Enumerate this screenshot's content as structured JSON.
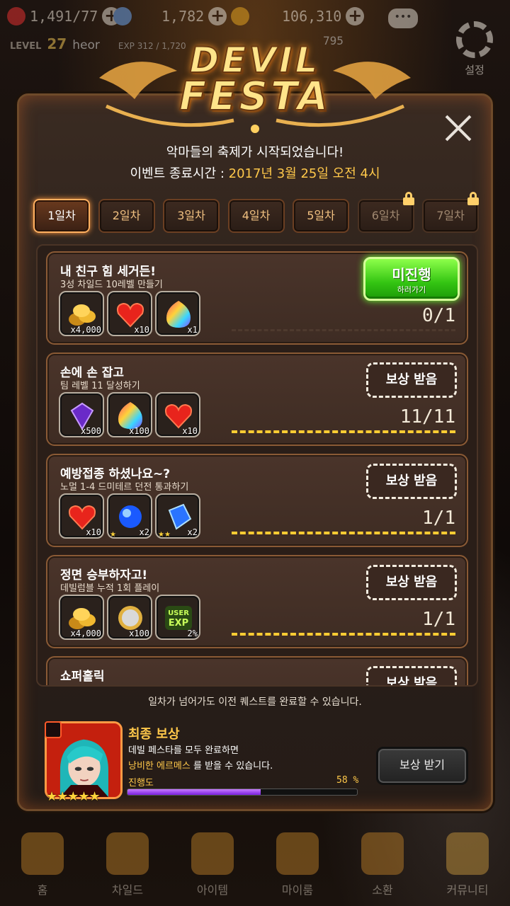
{
  "status_bar": {
    "stamina": "1,491/77",
    "gems": "1,782",
    "gold": "106,310",
    "stamina_extra": "795",
    "level_label": "LEVEL",
    "level": "27",
    "player_name": "heor",
    "exp": "EXP 312 / 1,720",
    "settings_label": "설정"
  },
  "logo": {
    "line1": "DEVIL",
    "line2": "FESTA"
  },
  "modal": {
    "subtitle": "악마들의 축제가 시작되었습니다!",
    "event_time_label": "이벤트 종료시간 : ",
    "event_time_value": "2017년 3월 25일 오전 4시",
    "tabs": [
      {
        "label": "1일차",
        "state": "active"
      },
      {
        "label": "2일차",
        "state": "normal"
      },
      {
        "label": "3일차",
        "state": "normal"
      },
      {
        "label": "4일차",
        "state": "normal"
      },
      {
        "label": "5일차",
        "state": "normal"
      },
      {
        "label": "6일차",
        "state": "locked"
      },
      {
        "label": "7일차",
        "state": "locked"
      }
    ],
    "quests": [
      {
        "title": "내 친구 힘 세거든!",
        "desc": "3성 차일드 10레벨 만들기",
        "rewards": [
          {
            "icon": "gold-coins-icon",
            "count": "x4,000"
          },
          {
            "icon": "heart-icon",
            "count": "x10"
          },
          {
            "icon": "rainbow-gem-icon",
            "count": "x1"
          }
        ],
        "progress": "0/1",
        "button": {
          "type": "in-progress",
          "line1": "미진행",
          "line2": "하러가기"
        }
      },
      {
        "title": "손에 손 잡고",
        "desc": "팀 레벨 11 달성하기",
        "rewards": [
          {
            "icon": "purple-crystal-icon",
            "count": "x500"
          },
          {
            "icon": "rainbow-gem-icon",
            "count": "x100"
          },
          {
            "icon": "heart-icon",
            "count": "x10"
          }
        ],
        "progress": "11/11",
        "button": {
          "type": "claim",
          "line1": "보상 받음"
        }
      },
      {
        "title": "예방접종 하셨나요~?",
        "desc": "노멀 1-4 드미테르 던전 통과하기",
        "rewards": [
          {
            "icon": "heart-icon",
            "count": "x10"
          },
          {
            "icon": "blue-orb-icon",
            "count": "x2",
            "stars": "★"
          },
          {
            "icon": "blue-crystal-icon",
            "count": "x2",
            "stars": "★★"
          }
        ],
        "progress": "1/1",
        "button": {
          "type": "claim",
          "line1": "보상 받음"
        }
      },
      {
        "title": "정면 승부하자고!",
        "desc": "데빌럼블 누적 1회 플레이",
        "rewards": [
          {
            "icon": "gold-coins-icon",
            "count": "x4,000"
          },
          {
            "icon": "silver-coin-icon",
            "count": "x100"
          },
          {
            "icon": "user-exp-icon",
            "count": "2%",
            "art_text1": "USER",
            "art_text2": "EXP"
          }
        ],
        "progress": "1/1",
        "button": {
          "type": "claim",
          "line1": "보상 받음"
        }
      },
      {
        "title": "쇼퍼홀릭",
        "desc": "",
        "rewards": [],
        "progress": "",
        "button": {
          "type": "claim",
          "line1": "보상 받음"
        }
      }
    ],
    "footer_note": "일차가 넘어가도 이전 퀘스트를 완료할 수 있습니다.",
    "final_reward": {
      "title": "최종 보상",
      "desc1": "데빌 페스타를 모두 완료하면",
      "desc2_highlight": "낭비한 에르메스",
      "desc2_rest": " 를 받을 수 있습니다.",
      "progress_label": "진행도",
      "progress_text": "58 %",
      "progress_value": 0.58,
      "stars": "★★★★★",
      "button_label": "보상 받기"
    }
  },
  "bottom_nav": [
    {
      "label": "홈",
      "icon": "home-gate-icon"
    },
    {
      "label": "차일드",
      "icon": "flame-eye-icon"
    },
    {
      "label": "아이템",
      "icon": "sword-shield-icon"
    },
    {
      "label": "마이룸",
      "icon": "crown-icon"
    },
    {
      "label": "소환",
      "icon": "summon-card-icon"
    },
    {
      "label": "커뮤니티",
      "icon": "community-shield-icon"
    }
  ],
  "colors": {
    "accent_gold": "#ffc84a",
    "button_green": "#33c412",
    "progress_purple": "#7a1fe0",
    "frame_brown": "#8a5a35"
  }
}
